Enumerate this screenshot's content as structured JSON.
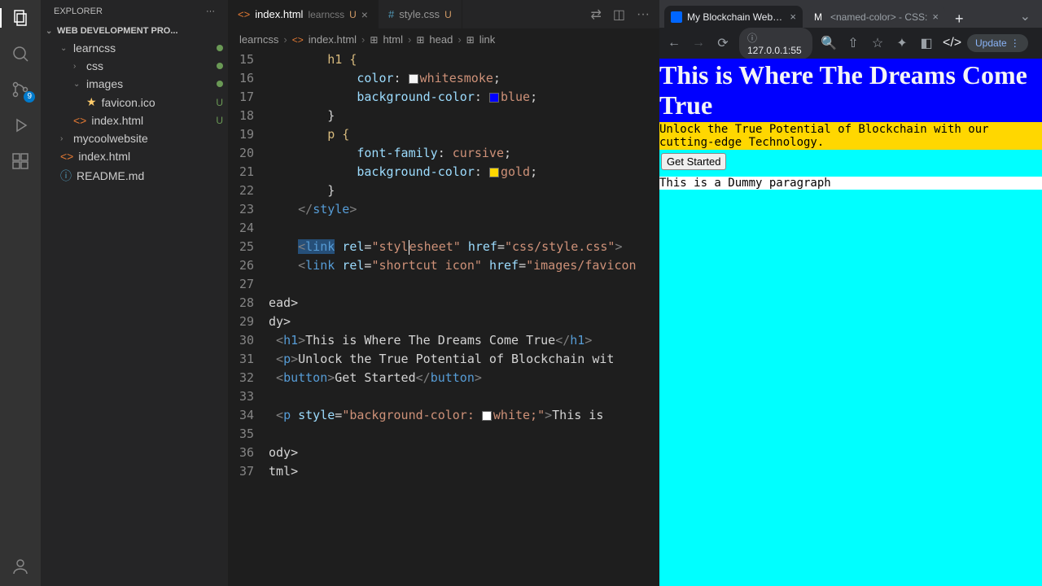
{
  "sidebar": {
    "title": "EXPLORER",
    "project": "WEB DEVELOPMENT PRO...",
    "tree": [
      {
        "label": "learncss",
        "dot": true
      },
      {
        "label": "css",
        "dot": true
      },
      {
        "label": "images",
        "dot": true
      },
      {
        "label": "favicon.ico",
        "status": "U"
      },
      {
        "label": "index.html",
        "status": "U"
      },
      {
        "label": "mycoolwebsite"
      },
      {
        "label": "index.html"
      },
      {
        "label": "README.md"
      }
    ]
  },
  "scm_badge": "9",
  "tabs": [
    {
      "label": "index.html",
      "suffix": "learncss",
      "mod": "U",
      "active": true
    },
    {
      "label": "style.css",
      "mod": "U",
      "active": false
    }
  ],
  "breadcrumb": [
    "learncss",
    "index.html",
    "html",
    "head",
    "link"
  ],
  "code_lines": {
    "l15": "h1 {",
    "l16_prop": "color",
    "l16_val": "whitesmoke",
    "l17_prop": "background-color",
    "l17_val": "blue",
    "l19": "p {",
    "l20_prop": "font-family",
    "l20_val": "cursive",
    "l21_prop": "background-color",
    "l21_val": "gold",
    "l23": "</style>",
    "l25_tag": "link",
    "l25_rel": "\"stylesheet\"",
    "l25_href": "\"css/style.css\"",
    "l26_tag": "link",
    "l26_rel": "\"shortcut icon\"",
    "l26_href": "\"images/favicon",
    "l28": "ead>",
    "l29": "dy>",
    "l30_text": "This is Where The Dreams Come True",
    "l31_text": "Unlock the True Potential of Blockchain wit",
    "l32_text": "Get Started",
    "l34_style": "\"background-color: ",
    "l34_val": "white",
    "l34_text": "This is ",
    "l36": "ody>",
    "l37": "tml>"
  },
  "browser": {
    "tabs": [
      {
        "title": "My Blockchain Website",
        "active": true
      },
      {
        "title": "<named-color> - CSS:",
        "active": false
      }
    ],
    "url": "127.0.0.1:55",
    "update": "Update"
  },
  "page": {
    "h1": "This is Where The Dreams Come True",
    "p1": "Unlock the True Potential of Blockchain with our cutting-edge Technology.",
    "button": "Get Started",
    "p2": "This is a Dummy paragraph"
  }
}
